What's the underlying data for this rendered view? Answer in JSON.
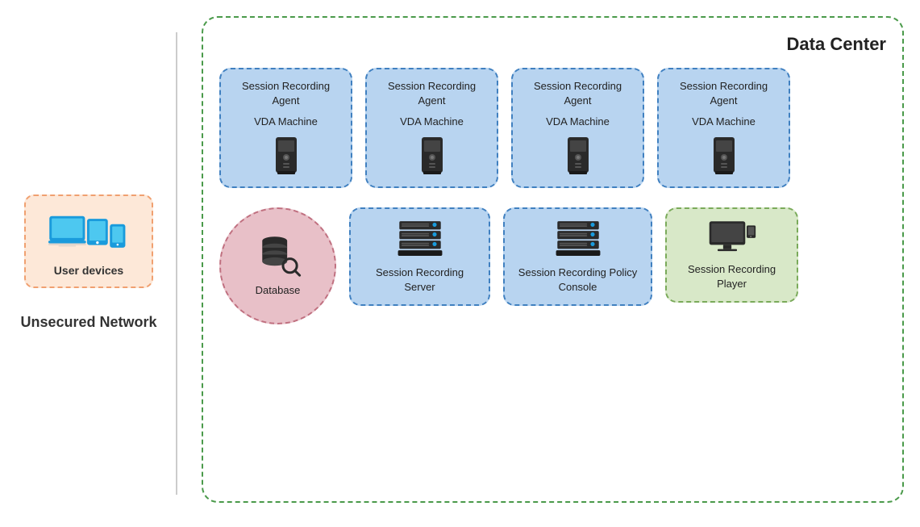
{
  "leftPanel": {
    "unsecuredNetwork": "Unsecured Network",
    "userDevices": "User devices"
  },
  "rightPanel": {
    "title": "Data Center",
    "agents": [
      {
        "label": "Session Recording Agent\n\nVDA Machine"
      },
      {
        "label": "Session Recording Agent\n\nVDA Machine"
      },
      {
        "label": "Session Recording Agent\n\nVDA Machine"
      },
      {
        "label": "Session Recording Agent\n\nVDA Machine"
      }
    ],
    "database": "Database",
    "sessionRecordingServer": "Session Recording Server",
    "sessionRecordingPolicyConsole": "Session Recording Policy Console",
    "sessionRecordingPlayer": "Session Recording Player"
  }
}
